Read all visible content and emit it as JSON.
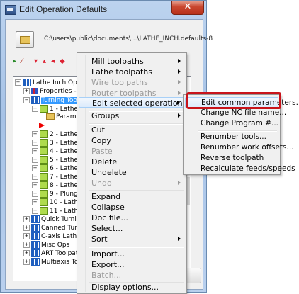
{
  "window": {
    "title": "Edit Operation Defaults",
    "close_glyph": "✕",
    "file_path": "C:\\users\\public\\documents\\...\\LATHE_INCH.defaults-8"
  },
  "tree": {
    "rows": [
      {
        "label": "Lathe Inch Opera",
        "icon": "grid"
      },
      {
        "label": "Properties - L",
        "icon": "props"
      },
      {
        "label": "Turning Tools",
        "icon": "grid",
        "selected": true
      },
      {
        "label": "1 - Lathe F",
        "icon": "check"
      },
      {
        "label": "Param",
        "icon": "folder"
      },
      {
        "label": "",
        "icon": "flag"
      },
      {
        "label": "2 - Lathe F",
        "icon": "check"
      },
      {
        "label": "3 - Lathe F",
        "icon": "check"
      },
      {
        "label": "4 - Lathe F",
        "icon": "check"
      },
      {
        "label": "5 - Lathe D",
        "icon": "check"
      },
      {
        "label": "6 - Lathe T",
        "icon": "check"
      },
      {
        "label": "7 - Lathe C",
        "icon": "check"
      },
      {
        "label": "8 - Lathe C",
        "icon": "check"
      },
      {
        "label": "9 - Plunge",
        "icon": "check"
      },
      {
        "label": "10 - Lathe",
        "icon": "check"
      },
      {
        "label": "11 - Lathe",
        "icon": "check"
      },
      {
        "label": "Quick Turning",
        "icon": "grid"
      },
      {
        "label": "Canned Turni",
        "icon": "grid"
      },
      {
        "label": "C-axis Lathe T",
        "icon": "grid"
      },
      {
        "label": "Misc Ops",
        "icon": "grid"
      },
      {
        "label": "ART Toolpat",
        "icon": "grid"
      },
      {
        "label": "Multiaxis Too",
        "icon": "grid"
      }
    ]
  },
  "context_menu": {
    "items": [
      {
        "label": "Mill toolpaths",
        "submenu": true,
        "disabled": false
      },
      {
        "label": "Lathe toolpaths",
        "submenu": true,
        "disabled": false
      },
      {
        "label": "Wire toolpaths",
        "submenu": true,
        "disabled": true
      },
      {
        "label": "Router toolpaths",
        "submenu": true,
        "disabled": true
      },
      {
        "label": "Edit selected operations",
        "submenu": true,
        "disabled": false,
        "hover": true
      },
      {
        "label": "Groups",
        "submenu": true,
        "disabled": false
      },
      {
        "label": "Cut",
        "submenu": false,
        "disabled": false
      },
      {
        "label": "Copy",
        "submenu": false,
        "disabled": false
      },
      {
        "label": "Paste",
        "submenu": false,
        "disabled": true
      },
      {
        "label": "Delete",
        "submenu": false,
        "disabled": false
      },
      {
        "label": "Undelete",
        "submenu": false,
        "disabled": false
      },
      {
        "label": "Undo",
        "submenu": true,
        "disabled": true
      },
      {
        "label": "Expand",
        "submenu": false,
        "disabled": false
      },
      {
        "label": "Collapse",
        "submenu": false,
        "disabled": false
      },
      {
        "label": "Doc file...",
        "submenu": false,
        "disabled": false
      },
      {
        "label": "Select...",
        "submenu": false,
        "disabled": false
      },
      {
        "label": "Sort",
        "submenu": true,
        "disabled": false
      },
      {
        "label": "Import...",
        "submenu": false,
        "disabled": false
      },
      {
        "label": "Export...",
        "submenu": false,
        "disabled": false
      },
      {
        "label": "Batch...",
        "submenu": false,
        "disabled": true
      },
      {
        "label": "Display options...",
        "submenu": false,
        "disabled": false
      }
    ]
  },
  "submenu": {
    "items": [
      {
        "label": "Edit common parameters...",
        "hover": true
      },
      {
        "label": "Change NC file name..."
      },
      {
        "label": "Change Program #..."
      },
      {
        "label": "Renumber tools..."
      },
      {
        "label": "Renumber work offsets..."
      },
      {
        "label": "Reverse toolpath"
      },
      {
        "label": "Recalculate feeds/speeds"
      }
    ]
  },
  "colors": {
    "highlight": "#c8141b",
    "selection": "#3399ff"
  }
}
